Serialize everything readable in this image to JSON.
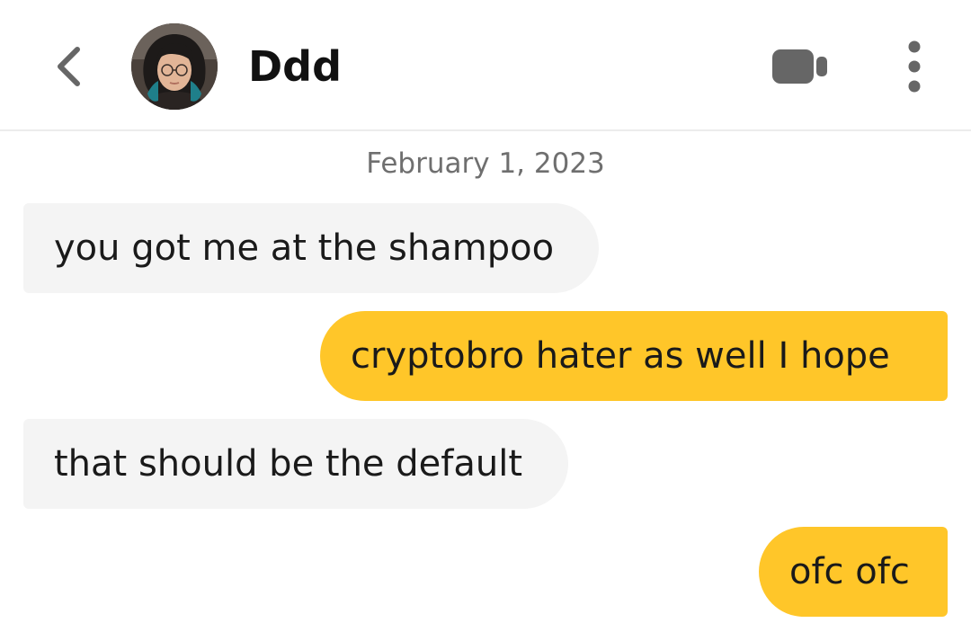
{
  "header": {
    "contact_name": "Ddd",
    "icons": {
      "back": "chevron-left-icon",
      "video": "video-camera-icon",
      "more": "more-vertical-icon"
    }
  },
  "date_separator": "February 1, 2023",
  "messages": [
    {
      "direction": "incoming",
      "text": "you got me at the shampoo"
    },
    {
      "direction": "outgoing",
      "text": "cryptobro hater as well I hope"
    },
    {
      "direction": "incoming",
      "text": "that should be the default"
    },
    {
      "direction": "outgoing",
      "text": "ofc ofc"
    }
  ],
  "colors": {
    "outgoing_bubble": "#ffc629",
    "incoming_bubble": "#f4f4f4",
    "icon": "#666666",
    "text": "#1a1a1a",
    "date_text": "#6f6f6f"
  }
}
